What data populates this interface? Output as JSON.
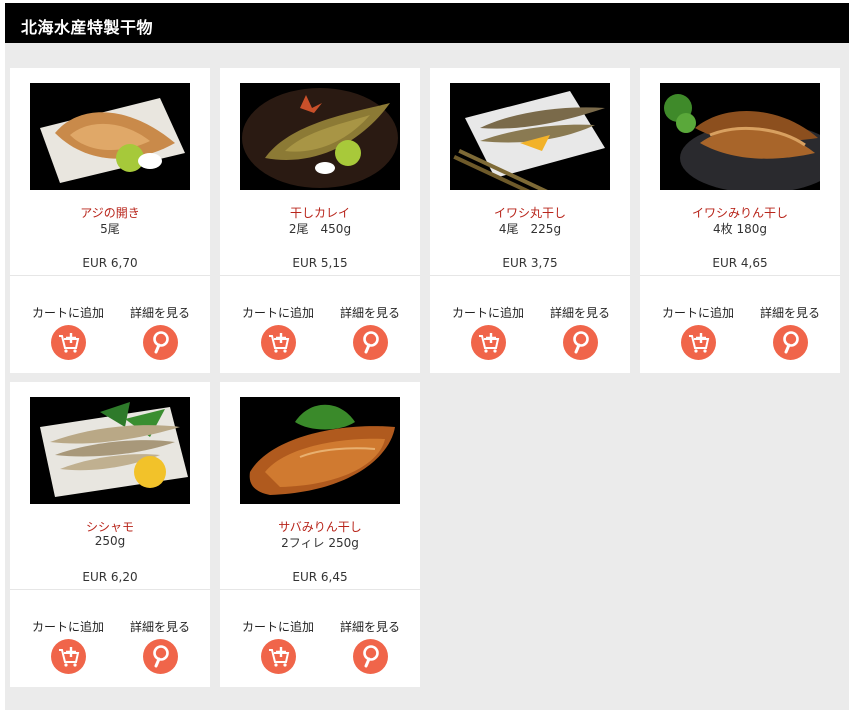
{
  "page": {
    "title": "北海水産特製干物"
  },
  "products": [
    {
      "name": "アジの開き",
      "desc": "5尾",
      "price": "EUR 6,70",
      "cart_label": "カートに追加",
      "detail_label": "詳細を見る"
    },
    {
      "name": "干しカレイ",
      "desc": "2尾　450g",
      "price": "EUR 5,15",
      "cart_label": "カートに追加",
      "detail_label": "詳細を見る"
    },
    {
      "name": "イワシ丸干し",
      "desc": "4尾　225g",
      "price": "EUR 3,75",
      "cart_label": "カートに追加",
      "detail_label": "詳細を見る"
    },
    {
      "name": "イワシみりん干し",
      "desc": "4枚 180g",
      "price": "EUR 4,65",
      "cart_label": "カートに追加",
      "detail_label": "詳細を見る"
    },
    {
      "name": "シシャモ",
      "desc": "250g",
      "price": "EUR 6,20",
      "cart_label": "カートに追加",
      "detail_label": "詳細を見る"
    },
    {
      "name": "サバみりん干し",
      "desc": "2フィレ 250g",
      "price": "EUR 6,45",
      "cart_label": "カートに追加",
      "detail_label": "詳細を見る"
    }
  ],
  "icons": {
    "cart": "cart-plus-icon",
    "detail": "magnifier-icon"
  },
  "colors": {
    "accent": "#f0654a",
    "product_name": "#b8251b",
    "header_bg": "#000000"
  }
}
